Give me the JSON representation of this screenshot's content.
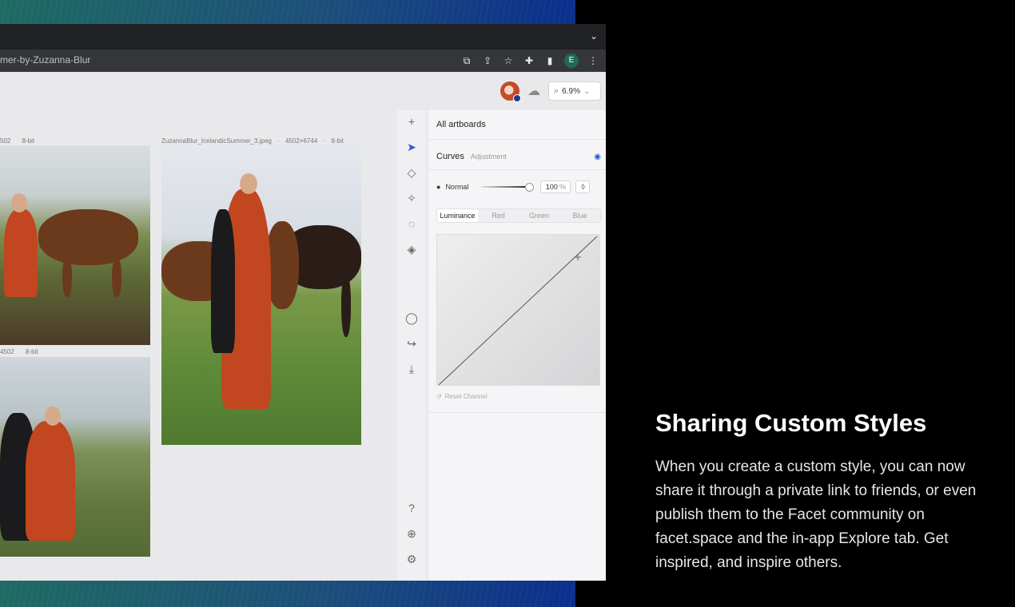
{
  "browser": {
    "url_fragment": "mer-by-Zuzanna-Blur",
    "tab_chevron_icon": "chevron-down-icon",
    "toolbar_icons": [
      "open-external-icon",
      "share-icon",
      "bookmark-star-icon",
      "extensions-icon",
      "sidebar-icon",
      "profile-icon",
      "more-icon"
    ],
    "profile_letter": "E"
  },
  "app": {
    "zoom_value": "6.9%",
    "artboards": [
      {
        "meta_left": "502",
        "meta_bits": "8-bit"
      },
      {
        "filename": "ZuzannaBlur_IcelandicSummer_3.jpeg",
        "dimensions": "4502×6744",
        "bits": "8-bit"
      },
      {
        "meta_left": "4502",
        "meta_bits": "8-bit"
      }
    ],
    "tools": [
      "plus-icon",
      "select-arrow-icon",
      "cube-icon",
      "magic-wand-icon",
      "bulb-icon",
      "paint-bucket-icon"
    ],
    "tools_lower": [
      "comment-icon",
      "share-arrow-icon",
      "download-icon"
    ],
    "tools_bottom": [
      "help-icon",
      "globe-icon",
      "settings-icon"
    ]
  },
  "panel": {
    "all_artboards": "All artboards",
    "layer_title": "Curves",
    "layer_subtitle": "Adjustment",
    "blend_mode": "Normal",
    "opacity": "100",
    "opacity_unit": "%",
    "tabs": [
      {
        "label": "Luminance",
        "active": true
      },
      {
        "label": "Red",
        "active": false
      },
      {
        "label": "Green",
        "active": false
      },
      {
        "label": "Blue",
        "active": false
      }
    ],
    "reset_label": "Reset Channel"
  },
  "promo": {
    "headline": "Sharing Custom Styles",
    "body": "When you create a custom style, you can now share it through a private link to friends, or even publish them to the Facet community on facet.space and the in-app Explore tab. Get inspired, and inspire others."
  },
  "colors": {
    "accent": "#2758d6",
    "background": "#000000"
  }
}
